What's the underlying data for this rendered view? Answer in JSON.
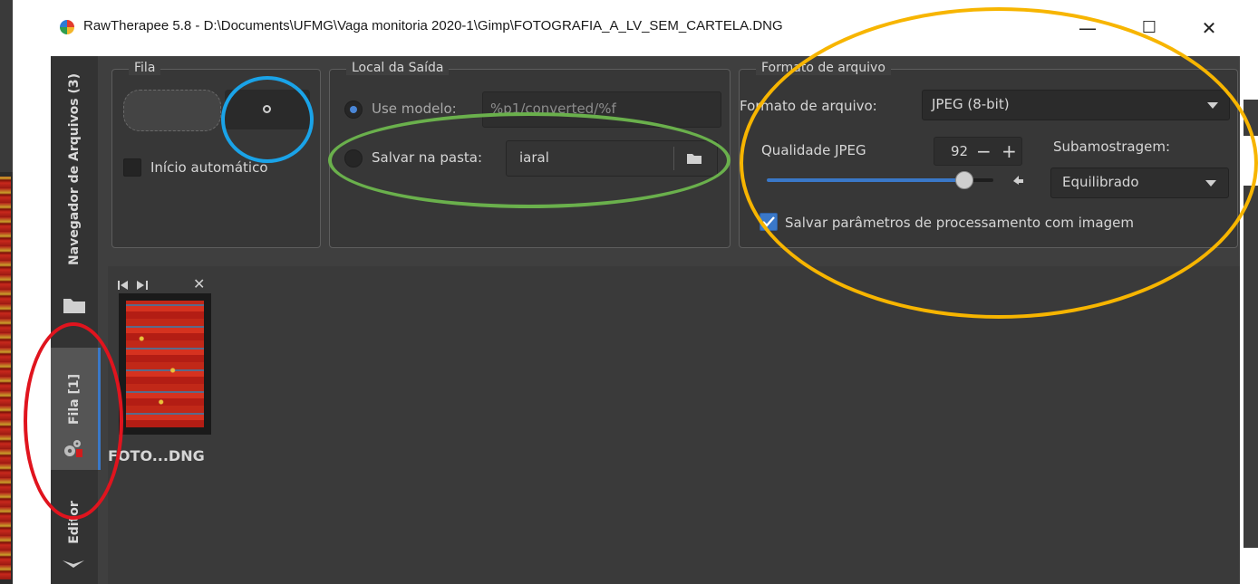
{
  "window": {
    "title": "RawTherapee 5.8 - D:\\Documents\\UFMG\\Vaga monitoria 2020-1\\Gimp\\FOTOGRAFIA_A_LV_SEM_CARTELA.DNG",
    "minimize": "—",
    "maximize": "☐",
    "close": "✕"
  },
  "sidebar": {
    "file_browser_tab": "Navegador de Arquivos (3)",
    "queue_tab": "Fila [1]",
    "editor_tab": "Editor"
  },
  "queue_group": {
    "label": "Fila",
    "auto_start_label": "Início automático"
  },
  "output_group": {
    "label": "Local da Saída",
    "use_template_label": "Use modelo:",
    "template_value": "%p1/converted/%f",
    "save_in_folder_label": "Salvar na pasta:",
    "folder_value": "iaral"
  },
  "format_group": {
    "label": "Formato de arquivo",
    "file_format_label": "Formato de arquivo:",
    "file_format_value": "JPEG (8-bit)",
    "jpeg_quality_label": "Qualidade JPEG",
    "jpeg_quality_value": "92",
    "minus": "−",
    "plus": "+",
    "subsampling_label": "Subamostragem:",
    "subsampling_value": "Equilibrado",
    "save_params_label": "Salvar parâmetros de processamento com imagem"
  },
  "queue_item": {
    "filename": "FOTO...DNG"
  },
  "colors": {
    "annotation_blue": "#1aa3e8",
    "annotation_green": "#6ab04c",
    "annotation_orange": "#f7b500",
    "annotation_red": "#e0141e",
    "accent": "#3a78c8"
  },
  "icons": {
    "app": "rawtherapee-logo-icon",
    "folder": "folder-icon",
    "gear": "gears-icon",
    "reset": "reset-arrow-icon",
    "dropdown": "chevron-down-icon"
  }
}
